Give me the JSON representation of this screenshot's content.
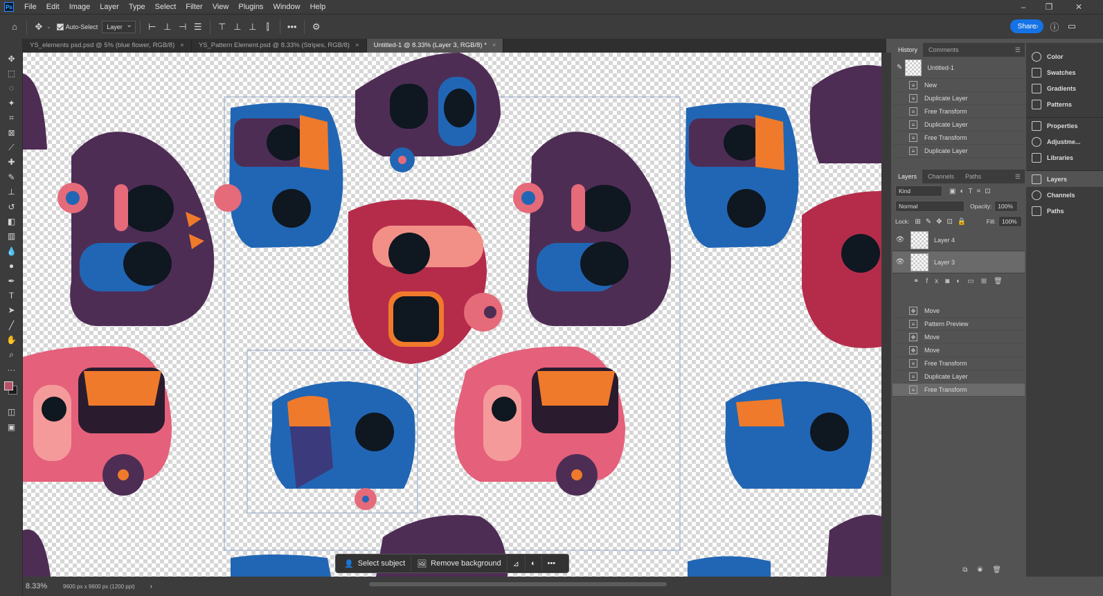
{
  "app": {
    "logo": "Ps"
  },
  "menu": [
    "File",
    "Edit",
    "Image",
    "Layer",
    "Type",
    "Select",
    "Filter",
    "View",
    "Plugins",
    "Window",
    "Help"
  ],
  "window_controls": {
    "minimize": "–",
    "restore": "❐",
    "close": "✕"
  },
  "options": {
    "auto_select_label": "Auto-Select",
    "target": "Layer",
    "share_label": "Share",
    "more_glyph": "•••"
  },
  "tabs": [
    {
      "label": "YS_elements psd.psd @ 5% (blue flower, RGB/8)",
      "close": "×"
    },
    {
      "label": "YS_Pattern Element.psd @ 8.33% (Stripes, RGB/8)",
      "close": "×"
    },
    {
      "label": "Untitled-1 @ 8.33% (Layer 3, RGB/8) *",
      "close": "×"
    }
  ],
  "status": {
    "zoom": "8.33%",
    "doc_info": "9600 px x 9600 px (1200 ppi)",
    "arrow": "›"
  },
  "context_bar": {
    "select_subject": "Select subject",
    "remove_background": "Remove background",
    "more": "•••"
  },
  "history": {
    "tabs": [
      "History",
      "Comments"
    ],
    "snapshot": "Untitled-1",
    "items": [
      "New",
      "Duplicate Layer",
      "Free Transform",
      "Duplicate Layer",
      "Free Transform",
      "Duplicate Layer"
    ],
    "items2": [
      "Move",
      "Pattern Preview",
      "Move",
      "Move",
      "Free Transform",
      "Duplicate Layer",
      "Free Transform"
    ]
  },
  "layers": {
    "tabs": [
      "Layers",
      "Channels",
      "Paths"
    ],
    "kind": "Kind",
    "blend": "Normal",
    "opacity_label": "Opacity:",
    "opacity": "100%",
    "lock_label": "Lock:",
    "fill_label": "Fill:",
    "fill": "100%",
    "items": [
      {
        "name": "Layer 4",
        "eye": "👁"
      },
      {
        "name": "Layer 3",
        "eye": "👁"
      }
    ],
    "fx": "fx"
  },
  "side_panels": [
    "Color",
    "Swatches",
    "Gradients",
    "Patterns",
    "Properties",
    "Adjustme...",
    "Libraries",
    "Layers",
    "Channels",
    "Paths"
  ],
  "colors": {
    "foreground": "#b7516a",
    "background": "#1c1c1c",
    "accent": "#1473e6",
    "purple": "#4e2d55",
    "blue": "#2166b4",
    "red": "#b52c4b",
    "pink": "#e56a7a",
    "orange": "#f07a2b"
  }
}
